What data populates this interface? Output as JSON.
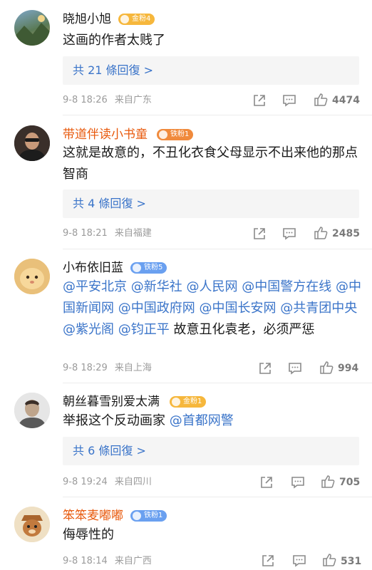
{
  "comments": [
    {
      "username": "晓旭小旭",
      "badge": "金粉4",
      "text": "这画的作者太贱了",
      "replies": "共 21 條回復 >",
      "time": "9-8 18:26",
      "location": "来自广东",
      "likes": "4474"
    },
    {
      "username": "带道伴读小书童",
      "badge": "铁粉1",
      "text": "这就是故意的，不丑化衣食父母显示不出来他的那点智商",
      "replies": "共 4 條回復 >",
      "time": "9-8 18:21",
      "location": "来自福建",
      "likes": "2485"
    },
    {
      "username": "小布依旧蓝",
      "badge": "铁粉5",
      "mentions": [
        "@平安北京",
        "@新华社",
        "@人民网",
        "@中国警方在线",
        "@中国新闻网",
        "@中国政府网",
        "@中国长安网",
        "@共青团中央",
        "@紫光阁",
        "@钧正平"
      ],
      "text_tail": " 故意丑化袁老，必须严惩",
      "time": "9-8 18:29",
      "location": "来自上海",
      "likes": "994"
    },
    {
      "username": "朝丝暮雪别爱太满",
      "badge": "金粉1",
      "text_head": "举报这个反动画家 ",
      "mention": "@首都网警",
      "replies": "共 6 條回復 >",
      "time": "9-8 19:24",
      "location": "来自四川",
      "likes": "705"
    },
    {
      "username": "笨笨麦嘟嘟",
      "badge": "铁粉1",
      "text": "侮辱性的",
      "time": "9-8 18:14",
      "location": "来自广西",
      "likes": "531"
    }
  ],
  "colors": {
    "link": "#3a74c9",
    "vip_name": "#e8590c",
    "badge_gold": "#f6b73c",
    "badge_iron": "#6aa0f0",
    "meta": "#9b9b9b"
  },
  "icons": [
    "share-icon",
    "comment-icon",
    "like-icon"
  ]
}
